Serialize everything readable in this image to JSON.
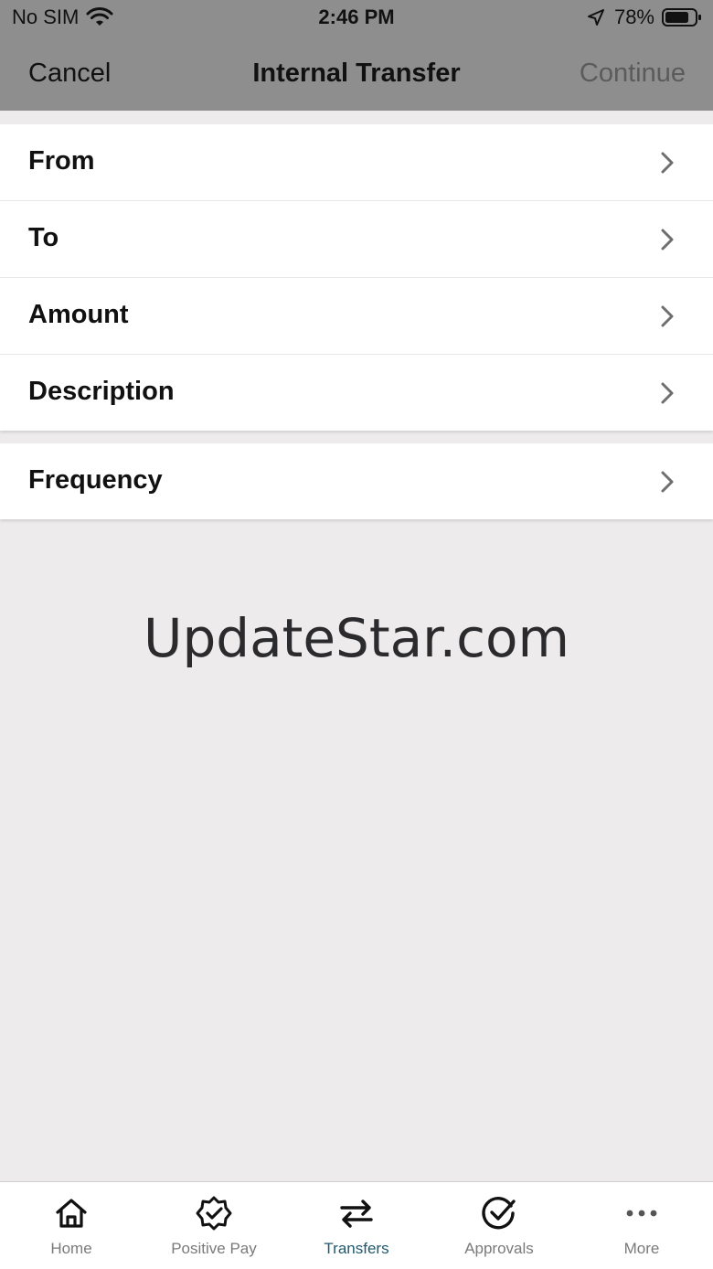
{
  "status_bar": {
    "carrier": "No SIM",
    "time": "2:46 PM",
    "battery": "78%"
  },
  "nav": {
    "cancel": "Cancel",
    "title": "Internal Transfer",
    "continue": "Continue"
  },
  "form": {
    "rows": [
      {
        "label": "From"
      },
      {
        "label": "To"
      },
      {
        "label": "Amount"
      },
      {
        "label": "Description"
      }
    ],
    "frequency": {
      "label": "Frequency"
    }
  },
  "watermark": "UpdateStar.com",
  "tabs": [
    {
      "label": "Home",
      "icon": "home-icon"
    },
    {
      "label": "Positive Pay",
      "icon": "verified-badge-icon"
    },
    {
      "label": "Transfers",
      "icon": "transfer-arrows-icon",
      "active": true
    },
    {
      "label": "Approvals",
      "icon": "check-circle-icon"
    },
    {
      "label": "More",
      "icon": "more-dots-icon"
    }
  ],
  "colors": {
    "header_bg": "#8e8e8f",
    "page_bg": "#edebec",
    "active_tab": "#1e5a6e"
  }
}
